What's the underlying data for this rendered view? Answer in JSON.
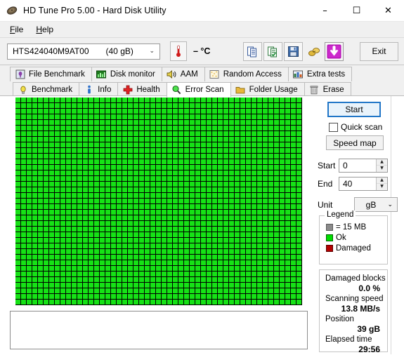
{
  "window": {
    "title": "HD Tune Pro 5.00 - Hard Disk Utility",
    "icon": "hard-disk-icon",
    "minimize": "–",
    "maximize": "☐",
    "close": "✕"
  },
  "menu": {
    "items": [
      {
        "label": "File",
        "mnemonic": "F"
      },
      {
        "label": "Help",
        "mnemonic": "H"
      }
    ]
  },
  "toolbar": {
    "drive": {
      "model": "HTS424040M9AT00",
      "size": "(40 gB)",
      "arrow": "⌄"
    },
    "temperature": {
      "icon": "thermometer-icon",
      "value": "– °C"
    },
    "buttons": [
      {
        "icon": "copy-icon",
        "name": "copy-button"
      },
      {
        "icon": "copy-green-icon",
        "name": "copy-report-button"
      },
      {
        "icon": "save-floppy-icon",
        "name": "save-button"
      },
      {
        "icon": "network-icon",
        "name": "network-button"
      },
      {
        "icon": "download-arrow-icon",
        "name": "download-button"
      }
    ],
    "exit_label": "Exit"
  },
  "tabs": {
    "row1": [
      {
        "label": "File Benchmark",
        "icon": "file-benchmark-icon",
        "active": false
      },
      {
        "label": "Disk monitor",
        "icon": "disk-monitor-icon",
        "active": false
      },
      {
        "label": "AAM",
        "icon": "speaker-icon",
        "active": false
      },
      {
        "label": "Random Access",
        "icon": "random-access-icon",
        "active": false
      },
      {
        "label": "Extra tests",
        "icon": "extra-tests-icon",
        "active": false
      }
    ],
    "row2": [
      {
        "label": "Benchmark",
        "icon": "benchmark-bulb-icon",
        "active": false
      },
      {
        "label": "Info",
        "icon": "info-icon",
        "active": false
      },
      {
        "label": "Health",
        "icon": "health-cross-icon",
        "active": false
      },
      {
        "label": "Error Scan",
        "icon": "magnifier-icon",
        "active": true
      },
      {
        "label": "Folder Usage",
        "icon": "folder-icon",
        "active": false
      },
      {
        "label": "Erase",
        "icon": "trash-icon",
        "active": false
      }
    ]
  },
  "panel": {
    "start_label": "Start",
    "quick_scan": {
      "label": "Quick scan",
      "checked": false
    },
    "speed_map_label": "Speed map",
    "fields": [
      {
        "label": "Start",
        "value": "0"
      },
      {
        "label": "End",
        "value": "40"
      }
    ],
    "unit": {
      "label": "Unit",
      "value": "gB",
      "arrow": "⌄"
    }
  },
  "legend": {
    "title": "Legend",
    "items": [
      {
        "label": "= 15 MB",
        "color": "#8a8a8a",
        "swatch": "sw-gray"
      },
      {
        "label": "Ok",
        "color": "#00dc00",
        "swatch": "sw-green"
      },
      {
        "label": "Damaged",
        "color": "#b40000",
        "swatch": "sw-red"
      }
    ]
  },
  "stats": [
    {
      "label": "Damaged blocks",
      "value": "0.0 %"
    },
    {
      "label": "Scanning speed",
      "value": "13.8 MB/s"
    },
    {
      "label": "Position",
      "value": "39 gB"
    },
    {
      "label": "Elapsed time",
      "value": "29:56"
    }
  ],
  "scan_map": {
    "columns": 51,
    "rows": 37,
    "total_blocks": 1887,
    "filled_blocks": 1887,
    "block_color_ok": "#16e216",
    "background": "#000000"
  },
  "log": {
    "text": ""
  }
}
